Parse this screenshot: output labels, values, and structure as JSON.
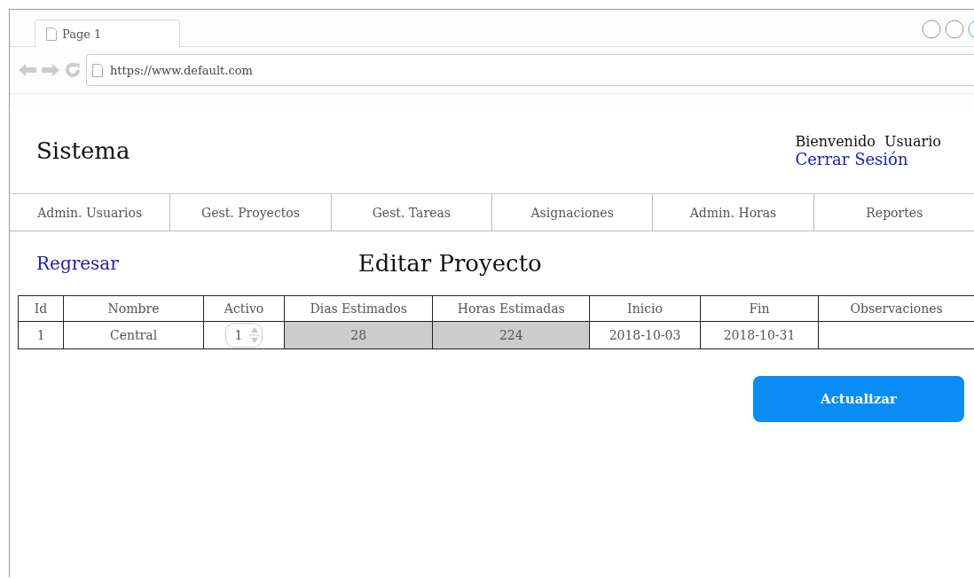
{
  "browser": {
    "tab": "Page 1",
    "url": "https://www.default.com"
  },
  "header": {
    "title": "Sistema",
    "welcome": "Bienvenido  Usuario",
    "logout": "Cerrar Sesión"
  },
  "nav": [
    "Admin. Usuarios",
    "Gest. Proyectos",
    "Gest. Tareas",
    "Asignaciones",
    "Admin. Horas",
    "Reportes"
  ],
  "back_link": "Regresar",
  "page_title": "Editar Proyecto",
  "table": {
    "columns": [
      "Id",
      "Nombre",
      "Activo",
      "Dias Estimados",
      "Horas Estimadas",
      "Inicio",
      "Fin",
      "Observaciones"
    ],
    "rows": [
      [
        {
          "kind": "text",
          "value": "1"
        },
        {
          "kind": "text",
          "value": "Central"
        },
        {
          "kind": "spinner",
          "value": "1"
        },
        {
          "kind": "readonly",
          "value": "28"
        },
        {
          "kind": "readonly",
          "value": "224"
        },
        {
          "kind": "text",
          "value": "2018-10-03"
        },
        {
          "kind": "text",
          "value": "2018-10-31"
        },
        {
          "kind": "input"
        }
      ]
    ]
  },
  "button": "Actualizar"
}
